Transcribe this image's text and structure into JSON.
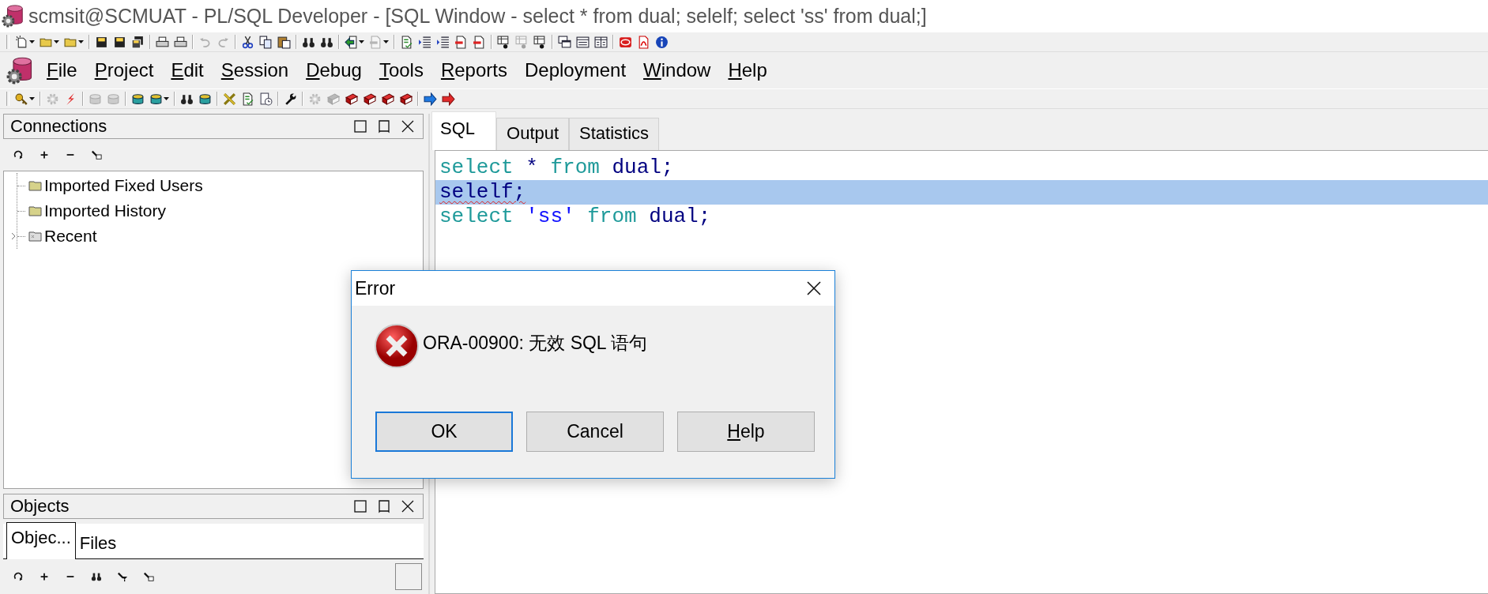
{
  "window": {
    "title": "scmsit@SCMUAT - PL/SQL Developer - [SQL Window - select * from dual; selelf; select 'ss' from dual;]"
  },
  "toolbar_top": [
    {
      "kind": "new",
      "disabled": false,
      "dropdown": true
    },
    {
      "kind": "folder",
      "disabled": false,
      "dropdown": true
    },
    {
      "kind": "folder",
      "disabled": false,
      "dropdown": true
    },
    {
      "kind": "separator"
    },
    {
      "kind": "floppy",
      "disabled": false,
      "dropdown": false
    },
    {
      "kind": "floppy",
      "disabled": false,
      "dropdown": false
    },
    {
      "kind": "floppies",
      "disabled": false,
      "dropdown": false
    },
    {
      "kind": "separator"
    },
    {
      "kind": "printer",
      "disabled": false,
      "dropdown": false
    },
    {
      "kind": "printer",
      "disabled": false,
      "dropdown": false
    },
    {
      "kind": "separator"
    },
    {
      "kind": "undo",
      "disabled": true,
      "dropdown": false
    },
    {
      "kind": "redo",
      "disabled": true,
      "dropdown": false
    },
    {
      "kind": "separator"
    },
    {
      "kind": "scissors",
      "disabled": false,
      "dropdown": false
    },
    {
      "kind": "copy",
      "disabled": false,
      "dropdown": false
    },
    {
      "kind": "paste",
      "disabled": false,
      "dropdown": false
    },
    {
      "kind": "separator"
    },
    {
      "kind": "binoculars",
      "disabled": false,
      "dropdown": false
    },
    {
      "kind": "binoculars",
      "disabled": false,
      "dropdown": false
    },
    {
      "kind": "separator"
    },
    {
      "kind": "arrow-in",
      "disabled": false,
      "dropdown": true
    },
    {
      "kind": "document",
      "disabled": true,
      "dropdown": true
    },
    {
      "kind": "separator"
    },
    {
      "kind": "checklist",
      "disabled": false,
      "dropdown": false
    },
    {
      "kind": "indent",
      "disabled": false,
      "dropdown": false
    },
    {
      "kind": "indent",
      "disabled": false,
      "dropdown": false
    },
    {
      "kind": "document",
      "disabled": false,
      "dropdown": false
    },
    {
      "kind": "document",
      "disabled": false,
      "dropdown": false
    },
    {
      "kind": "separator"
    },
    {
      "kind": "query",
      "disabled": false,
      "dropdown": false
    },
    {
      "kind": "query",
      "disabled": true,
      "dropdown": false
    },
    {
      "kind": "query",
      "disabled": false,
      "dropdown": false
    },
    {
      "kind": "separator"
    },
    {
      "kind": "windows",
      "disabled": false,
      "dropdown": false
    },
    {
      "kind": "list",
      "disabled": false,
      "dropdown": false
    },
    {
      "kind": "columns",
      "disabled": false,
      "dropdown": false
    },
    {
      "kind": "separator"
    },
    {
      "kind": "oval-logo",
      "disabled": false,
      "dropdown": false
    },
    {
      "kind": "pdf",
      "disabled": false,
      "dropdown": false
    },
    {
      "kind": "info",
      "disabled": false,
      "dropdown": false
    }
  ],
  "menu": [
    {
      "label": "File",
      "mnemonic": true
    },
    {
      "label": "Project",
      "mnemonic": true
    },
    {
      "label": "Edit",
      "mnemonic": true
    },
    {
      "label": "Session",
      "mnemonic": true
    },
    {
      "label": "Debug",
      "mnemonic": true
    },
    {
      "label": "Tools",
      "mnemonic": true
    },
    {
      "label": "Reports",
      "mnemonic": true
    },
    {
      "label": "Deployment",
      "mnemonic": false
    },
    {
      "label": "Window",
      "mnemonic": true
    },
    {
      "label": "Help",
      "mnemonic": true
    }
  ],
  "toolbar_bottom": [
    {
      "kind": "key",
      "disabled": false,
      "dropdown": true
    },
    {
      "kind": "separator"
    },
    {
      "kind": "gear",
      "disabled": true,
      "dropdown": false
    },
    {
      "kind": "lightning",
      "disabled": false,
      "dropdown": false
    },
    {
      "kind": "separator"
    },
    {
      "kind": "database",
      "disabled": true,
      "dropdown": false
    },
    {
      "kind": "database",
      "disabled": true,
      "dropdown": false
    },
    {
      "kind": "separator"
    },
    {
      "kind": "database",
      "disabled": false,
      "dropdown": false
    },
    {
      "kind": "database",
      "disabled": false,
      "dropdown": true
    },
    {
      "kind": "separator"
    },
    {
      "kind": "binoculars",
      "disabled": false,
      "dropdown": false
    },
    {
      "kind": "database",
      "disabled": false,
      "dropdown": false
    },
    {
      "kind": "separator"
    },
    {
      "kind": "tools",
      "disabled": false,
      "dropdown": false
    },
    {
      "kind": "checklist",
      "disabled": false,
      "dropdown": false
    },
    {
      "kind": "clock",
      "disabled": false,
      "dropdown": false
    },
    {
      "kind": "separator"
    },
    {
      "kind": "wrench",
      "disabled": false,
      "dropdown": false
    },
    {
      "kind": "separator"
    },
    {
      "kind": "gear",
      "disabled": true,
      "dropdown": false
    },
    {
      "kind": "book",
      "disabled": true,
      "dropdown": false
    },
    {
      "kind": "book",
      "disabled": false,
      "dropdown": false
    },
    {
      "kind": "book",
      "disabled": false,
      "dropdown": false
    },
    {
      "kind": "book",
      "disabled": false,
      "dropdown": false
    },
    {
      "kind": "book",
      "disabled": false,
      "dropdown": false
    },
    {
      "kind": "separator"
    },
    {
      "kind": "arrow-blue",
      "disabled": false,
      "dropdown": false
    },
    {
      "kind": "arrow-red",
      "disabled": false,
      "dropdown": false
    }
  ],
  "connections": {
    "title": "Connections",
    "tools": [
      {
        "kind": "refresh"
      },
      {
        "kind": "plus"
      },
      {
        "kind": "minus"
      },
      {
        "kind": "key-folder"
      }
    ],
    "tree": [
      {
        "label": "Imported Fixed Users",
        "kind": "folder",
        "expandable": false
      },
      {
        "label": "Imported History",
        "kind": "folder",
        "expandable": false
      },
      {
        "label": "Recent",
        "kind": "recent",
        "expandable": true
      }
    ]
  },
  "objects": {
    "title": "Objects",
    "tabs": [
      {
        "label": "Objec...",
        "selected": true
      },
      {
        "label": "Files",
        "selected": false
      }
    ],
    "tools": [
      {
        "kind": "refresh"
      },
      {
        "kind": "plus"
      },
      {
        "kind": "minus"
      },
      {
        "kind": "binoculars"
      },
      {
        "kind": "filter"
      },
      {
        "kind": "key-folder"
      }
    ]
  },
  "editor": {
    "tabs": [
      {
        "label": "SQL",
        "selected": true
      },
      {
        "label": "Output",
        "selected": false
      },
      {
        "label": "Statistics",
        "selected": false
      }
    ],
    "lines": [
      {
        "selected": false,
        "tokens": [
          {
            "text": "select",
            "kind": "keyword"
          },
          {
            "text": " * ",
            "kind": "plain"
          },
          {
            "text": "from",
            "kind": "keyword"
          },
          {
            "text": " dual;",
            "kind": "plain"
          }
        ]
      },
      {
        "selected": true,
        "tokens": [
          {
            "text": "selelf;",
            "kind": "error"
          }
        ]
      },
      {
        "selected": false,
        "tokens": [
          {
            "text": "select",
            "kind": "keyword"
          },
          {
            "text": " 'ss' ",
            "kind": "string"
          },
          {
            "text": "from",
            "kind": "keyword"
          },
          {
            "text": " dual;",
            "kind": "plain"
          }
        ]
      }
    ]
  },
  "dialog": {
    "title": "Error",
    "message": "ORA-00900: 无效 SQL 语句",
    "buttons": [
      {
        "label": "OK",
        "default": true,
        "mnemonic": false
      },
      {
        "label": "Cancel",
        "default": false,
        "mnemonic": false
      },
      {
        "label": "Help",
        "default": false,
        "mnemonic": true
      }
    ]
  }
}
